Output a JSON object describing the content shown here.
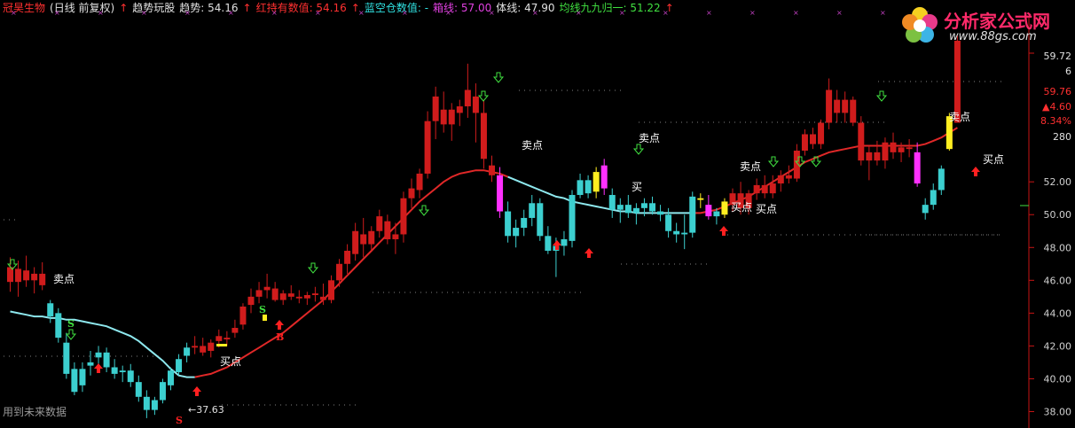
{
  "header": {
    "stock": "冠昊生物",
    "period": "(日线 前复权)",
    "indicator": "趋势玩股",
    "trend_label": "趋势: 54.16",
    "red_hold_label": "红持有数值: 54.16",
    "blue_empty_label": "蓝空仓数值: -",
    "box_label": "箱线: 57.00",
    "body_label": "体线: 47.90",
    "ma_label": "均线九九归一: 51.22",
    "colors": {
      "stock": "#ff3030",
      "white": "#e0e0e0",
      "red": "#ff3030",
      "cyan": "#30e0e0",
      "magenta": "#e040e0",
      "green": "#40e040"
    }
  },
  "watermark": "用到未来数据",
  "logo": {
    "text": "分析家公式网",
    "url": "www.88gs.com"
  },
  "chart_data": {
    "type": "candlestick",
    "ylim": [
      37,
      62
    ],
    "y_ticks": [
      38.0,
      40.0,
      42.0,
      44.0,
      46.0,
      48.0,
      50.0,
      52.0
    ],
    "right_labels": [
      "59.72",
      "6",
      "59.76",
      "▲4.60",
      "8.34%",
      "280"
    ],
    "low_marker": "←37.63",
    "up_color": "#d01c1c",
    "down_color": "#3ccfcf",
    "candles": [
      {
        "o": 46.8,
        "h": 47.4,
        "l": 45.3,
        "c": 45.9,
        "d": "up"
      },
      {
        "o": 45.9,
        "h": 47.2,
        "l": 45.0,
        "c": 46.7,
        "d": "up"
      },
      {
        "o": 46.6,
        "h": 47.5,
        "l": 45.6,
        "c": 46.0,
        "d": "up"
      },
      {
        "o": 46.0,
        "h": 46.8,
        "l": 45.2,
        "c": 46.4,
        "d": "up"
      },
      {
        "o": 46.4,
        "h": 47.1,
        "l": 45.4,
        "c": 45.7,
        "d": "up"
      },
      {
        "o": 44.6,
        "h": 44.8,
        "l": 43.4,
        "c": 43.8,
        "d": "dn"
      },
      {
        "o": 44.0,
        "h": 44.3,
        "l": 42.2,
        "c": 42.5,
        "d": "dn"
      },
      {
        "o": 42.2,
        "h": 42.8,
        "l": 40.0,
        "c": 40.3,
        "d": "dn"
      },
      {
        "o": 40.6,
        "h": 41.0,
        "l": 39.0,
        "c": 39.2,
        "d": "dn"
      },
      {
        "o": 39.6,
        "h": 41.0,
        "l": 39.2,
        "c": 40.6,
        "d": "dn"
      },
      {
        "o": 40.8,
        "h": 41.7,
        "l": 40.2,
        "c": 41.0,
        "d": "dn"
      },
      {
        "o": 41.3,
        "h": 42.0,
        "l": 40.6,
        "c": 41.6,
        "d": "dn"
      },
      {
        "o": 41.6,
        "h": 41.9,
        "l": 40.4,
        "c": 40.7,
        "d": "dn"
      },
      {
        "o": 40.7,
        "h": 41.2,
        "l": 40.0,
        "c": 40.3,
        "d": "dn"
      },
      {
        "o": 40.4,
        "h": 40.8,
        "l": 39.8,
        "c": 40.5,
        "d": "dn"
      },
      {
        "o": 40.5,
        "h": 40.9,
        "l": 39.5,
        "c": 39.8,
        "d": "dn"
      },
      {
        "o": 39.8,
        "h": 40.2,
        "l": 38.6,
        "c": 38.9,
        "d": "dn"
      },
      {
        "o": 38.9,
        "h": 39.3,
        "l": 37.6,
        "c": 38.1,
        "d": "dn"
      },
      {
        "o": 38.1,
        "h": 38.9,
        "l": 37.8,
        "c": 38.7,
        "d": "dn"
      },
      {
        "o": 38.7,
        "h": 40.0,
        "l": 38.5,
        "c": 39.8,
        "d": "dn"
      },
      {
        "o": 39.6,
        "h": 40.7,
        "l": 39.3,
        "c": 40.5,
        "d": "dn"
      },
      {
        "o": 40.4,
        "h": 41.5,
        "l": 40.2,
        "c": 41.2,
        "d": "dn"
      },
      {
        "o": 41.4,
        "h": 42.2,
        "l": 41.0,
        "c": 41.9,
        "d": "dn"
      },
      {
        "o": 41.9,
        "h": 42.6,
        "l": 41.5,
        "c": 42.0,
        "d": "up"
      },
      {
        "o": 42.0,
        "h": 42.5,
        "l": 41.4,
        "c": 41.6,
        "d": "up"
      },
      {
        "o": 41.7,
        "h": 42.4,
        "l": 41.3,
        "c": 42.2,
        "d": "up"
      },
      {
        "o": 42.3,
        "h": 43.0,
        "l": 41.9,
        "c": 42.6,
        "d": "up"
      },
      {
        "o": 42.5,
        "h": 42.9,
        "l": 42.0,
        "c": 42.4,
        "d": "up"
      },
      {
        "o": 42.8,
        "h": 43.6,
        "l": 42.5,
        "c": 43.1,
        "d": "up"
      },
      {
        "o": 43.3,
        "h": 44.6,
        "l": 43.0,
        "c": 44.4,
        "d": "up"
      },
      {
        "o": 44.5,
        "h": 45.5,
        "l": 44.0,
        "c": 45.0,
        "d": "up"
      },
      {
        "o": 45.0,
        "h": 45.9,
        "l": 44.6,
        "c": 45.4,
        "d": "up"
      },
      {
        "o": 45.4,
        "h": 46.4,
        "l": 44.9,
        "c": 45.6,
        "d": "up"
      },
      {
        "o": 45.5,
        "h": 45.9,
        "l": 44.7,
        "c": 44.8,
        "d": "up"
      },
      {
        "o": 44.8,
        "h": 45.4,
        "l": 44.5,
        "c": 45.2,
        "d": "up"
      },
      {
        "o": 45.2,
        "h": 45.7,
        "l": 44.8,
        "c": 45.0,
        "d": "up"
      },
      {
        "o": 45.0,
        "h": 45.4,
        "l": 44.6,
        "c": 44.9,
        "d": "up"
      },
      {
        "o": 44.9,
        "h": 45.3,
        "l": 44.5,
        "c": 45.1,
        "d": "up"
      },
      {
        "o": 45.1,
        "h": 45.6,
        "l": 44.7,
        "c": 45.2,
        "d": "up"
      },
      {
        "o": 45.0,
        "h": 45.8,
        "l": 44.5,
        "c": 44.8,
        "d": "up"
      },
      {
        "o": 44.8,
        "h": 46.3,
        "l": 44.6,
        "c": 46.0,
        "d": "up"
      },
      {
        "o": 46.0,
        "h": 47.3,
        "l": 45.6,
        "c": 47.0,
        "d": "up"
      },
      {
        "o": 47.0,
        "h": 48.2,
        "l": 46.4,
        "c": 47.8,
        "d": "up"
      },
      {
        "o": 47.6,
        "h": 49.5,
        "l": 47.2,
        "c": 49.0,
        "d": "up"
      },
      {
        "o": 48.8,
        "h": 49.8,
        "l": 47.4,
        "c": 48.2,
        "d": "up"
      },
      {
        "o": 48.2,
        "h": 49.3,
        "l": 47.8,
        "c": 49.0,
        "d": "up"
      },
      {
        "o": 49.0,
        "h": 50.3,
        "l": 48.6,
        "c": 49.9,
        "d": "up"
      },
      {
        "o": 49.6,
        "h": 50.0,
        "l": 48.2,
        "c": 48.5,
        "d": "up"
      },
      {
        "o": 48.5,
        "h": 49.5,
        "l": 47.6,
        "c": 48.8,
        "d": "up"
      },
      {
        "o": 48.8,
        "h": 51.4,
        "l": 48.3,
        "c": 51.0,
        "d": "up"
      },
      {
        "o": 51.0,
        "h": 52.2,
        "l": 50.4,
        "c": 51.6,
        "d": "up"
      },
      {
        "o": 51.5,
        "h": 52.8,
        "l": 51.0,
        "c": 52.5,
        "d": "up"
      },
      {
        "o": 52.5,
        "h": 56.3,
        "l": 52.2,
        "c": 55.7,
        "d": "up"
      },
      {
        "o": 55.7,
        "h": 57.8,
        "l": 54.6,
        "c": 57.2,
        "d": "up"
      },
      {
        "o": 56.4,
        "h": 57.5,
        "l": 55.0,
        "c": 55.5,
        "d": "up"
      },
      {
        "o": 55.5,
        "h": 56.8,
        "l": 54.5,
        "c": 56.4,
        "d": "up"
      },
      {
        "o": 56.2,
        "h": 57.0,
        "l": 55.4,
        "c": 56.6,
        "d": "up"
      },
      {
        "o": 56.6,
        "h": 59.2,
        "l": 55.9,
        "c": 57.6,
        "d": "up"
      },
      {
        "o": 57.2,
        "h": 58.0,
        "l": 54.4,
        "c": 56.2,
        "d": "up"
      },
      {
        "o": 56.2,
        "h": 57.0,
        "l": 52.8,
        "c": 53.4,
        "d": "up"
      },
      {
        "o": 53.0,
        "h": 53.6,
        "l": 52.0,
        "c": 52.4,
        "d": "up"
      },
      {
        "o": 52.4,
        "h": 52.9,
        "l": 49.8,
        "c": 50.2,
        "d": "mag"
      },
      {
        "o": 50.2,
        "h": 50.8,
        "l": 48.3,
        "c": 48.7,
        "d": "dn"
      },
      {
        "o": 48.7,
        "h": 49.7,
        "l": 48.0,
        "c": 49.2,
        "d": "dn"
      },
      {
        "o": 49.2,
        "h": 50.3,
        "l": 48.7,
        "c": 49.8,
        "d": "dn"
      },
      {
        "o": 49.8,
        "h": 51.2,
        "l": 49.3,
        "c": 50.7,
        "d": "dn"
      },
      {
        "o": 50.7,
        "h": 51.0,
        "l": 48.4,
        "c": 48.7,
        "d": "dn"
      },
      {
        "o": 48.7,
        "h": 49.3,
        "l": 47.6,
        "c": 47.8,
        "d": "dn"
      },
      {
        "o": 47.8,
        "h": 48.6,
        "l": 46.2,
        "c": 48.1,
        "d": "dn"
      },
      {
        "o": 48.1,
        "h": 49.0,
        "l": 47.5,
        "c": 48.5,
        "d": "dn"
      },
      {
        "o": 48.4,
        "h": 51.5,
        "l": 48.0,
        "c": 51.2,
        "d": "dn"
      },
      {
        "o": 51.2,
        "h": 52.5,
        "l": 51.0,
        "c": 52.1,
        "d": "dn"
      },
      {
        "o": 52.1,
        "h": 52.4,
        "l": 51.0,
        "c": 51.3,
        "d": "dn"
      },
      {
        "o": 51.4,
        "h": 52.9,
        "l": 51.0,
        "c": 52.6,
        "d": "ylw"
      },
      {
        "o": 51.6,
        "h": 53.4,
        "l": 51.2,
        "c": 53.0,
        "d": "mag"
      },
      {
        "o": 51.2,
        "h": 51.6,
        "l": 49.8,
        "c": 50.3,
        "d": "dn"
      },
      {
        "o": 50.3,
        "h": 51.0,
        "l": 49.5,
        "c": 50.6,
        "d": "dn"
      },
      {
        "o": 50.6,
        "h": 51.2,
        "l": 49.8,
        "c": 50.1,
        "d": "dn"
      },
      {
        "o": 50.1,
        "h": 50.7,
        "l": 49.4,
        "c": 50.4,
        "d": "dn"
      },
      {
        "o": 50.4,
        "h": 51.0,
        "l": 49.9,
        "c": 50.7,
        "d": "dn"
      },
      {
        "o": 50.7,
        "h": 51.1,
        "l": 50.0,
        "c": 50.2,
        "d": "dn"
      },
      {
        "o": 50.2,
        "h": 50.6,
        "l": 49.6,
        "c": 50.0,
        "d": "dn"
      },
      {
        "o": 50.0,
        "h": 50.4,
        "l": 48.6,
        "c": 49.0,
        "d": "dn"
      },
      {
        "o": 49.0,
        "h": 49.5,
        "l": 48.3,
        "c": 48.8,
        "d": "dn"
      },
      {
        "o": 48.8,
        "h": 50.0,
        "l": 47.9,
        "c": 48.9,
        "d": "dn"
      },
      {
        "o": 48.9,
        "h": 51.4,
        "l": 48.6,
        "c": 51.1,
        "d": "dn"
      },
      {
        "o": 50.9,
        "h": 51.3,
        "l": 50.4,
        "c": 51.0,
        "d": "ylw"
      },
      {
        "o": 50.6,
        "h": 51.2,
        "l": 49.7,
        "c": 49.9,
        "d": "mag"
      },
      {
        "o": 49.9,
        "h": 50.4,
        "l": 49.4,
        "c": 50.2,
        "d": "dn"
      },
      {
        "o": 50.0,
        "h": 51.0,
        "l": 49.8,
        "c": 50.8,
        "d": "ylw"
      },
      {
        "o": 50.6,
        "h": 51.6,
        "l": 50.2,
        "c": 51.3,
        "d": "up"
      },
      {
        "o": 51.3,
        "h": 52.0,
        "l": 50.0,
        "c": 50.4,
        "d": "up"
      },
      {
        "o": 50.4,
        "h": 51.5,
        "l": 50.0,
        "c": 51.3,
        "d": "up"
      },
      {
        "o": 51.3,
        "h": 52.2,
        "l": 50.9,
        "c": 51.8,
        "d": "up"
      },
      {
        "o": 51.8,
        "h": 52.4,
        "l": 51.0,
        "c": 51.3,
        "d": "up"
      },
      {
        "o": 51.3,
        "h": 52.4,
        "l": 51.0,
        "c": 51.9,
        "d": "up"
      },
      {
        "o": 51.9,
        "h": 52.7,
        "l": 51.4,
        "c": 52.4,
        "d": "up"
      },
      {
        "o": 52.4,
        "h": 53.0,
        "l": 51.9,
        "c": 52.2,
        "d": "up"
      },
      {
        "o": 52.2,
        "h": 54.3,
        "l": 52.0,
        "c": 53.9,
        "d": "up"
      },
      {
        "o": 53.9,
        "h": 55.2,
        "l": 53.6,
        "c": 54.9,
        "d": "up"
      },
      {
        "o": 54.9,
        "h": 55.3,
        "l": 54.0,
        "c": 54.3,
        "d": "up"
      },
      {
        "o": 54.3,
        "h": 55.8,
        "l": 54.0,
        "c": 55.6,
        "d": "up"
      },
      {
        "o": 55.6,
        "h": 58.3,
        "l": 55.2,
        "c": 57.6,
        "d": "up"
      },
      {
        "o": 57.0,
        "h": 57.6,
        "l": 55.6,
        "c": 56.2,
        "d": "up"
      },
      {
        "o": 56.2,
        "h": 57.5,
        "l": 55.6,
        "c": 57.0,
        "d": "up"
      },
      {
        "o": 57.0,
        "h": 57.2,
        "l": 55.4,
        "c": 55.6,
        "d": "up"
      },
      {
        "o": 55.6,
        "h": 56.0,
        "l": 53.0,
        "c": 53.3,
        "d": "up"
      },
      {
        "o": 53.3,
        "h": 54.2,
        "l": 52.1,
        "c": 53.8,
        "d": "up"
      },
      {
        "o": 53.8,
        "h": 54.5,
        "l": 53.0,
        "c": 53.3,
        "d": "up"
      },
      {
        "o": 53.3,
        "h": 54.7,
        "l": 52.8,
        "c": 54.4,
        "d": "up"
      },
      {
        "o": 54.4,
        "h": 55.0,
        "l": 53.4,
        "c": 53.8,
        "d": "up"
      },
      {
        "o": 53.8,
        "h": 54.4,
        "l": 53.2,
        "c": 54.1,
        "d": "up"
      },
      {
        "o": 54.1,
        "h": 54.6,
        "l": 53.5,
        "c": 54.0,
        "d": "up"
      },
      {
        "o": 53.8,
        "h": 54.4,
        "l": 51.7,
        "c": 51.9,
        "d": "mag"
      },
      {
        "o": 50.6,
        "h": 51.0,
        "l": 49.7,
        "c": 50.1,
        "d": "dn"
      },
      {
        "o": 50.6,
        "h": 51.9,
        "l": 50.3,
        "c": 51.5,
        "d": "dn"
      },
      {
        "o": 51.5,
        "h": 53.0,
        "l": 51.2,
        "c": 52.8,
        "d": "dn"
      },
      {
        "o": 54.0,
        "h": 56.2,
        "l": 53.9,
        "c": 56.0,
        "d": "ylw"
      },
      {
        "o": 55.6,
        "h": 60.9,
        "l": 55.6,
        "c": 60.6,
        "d": "up"
      }
    ],
    "ma_line": {
      "name": "均线九九归一",
      "values": [
        44.1,
        44.0,
        43.9,
        43.8,
        43.8,
        43.7,
        43.7,
        43.6,
        43.6,
        43.5,
        43.4,
        43.3,
        43.2,
        43.0,
        42.8,
        42.6,
        42.3,
        41.9,
        41.5,
        41.1,
        40.6,
        40.2,
        40.1,
        40.1,
        40.2,
        40.3,
        40.5,
        40.7,
        41.0,
        41.3,
        41.6,
        41.9,
        42.2,
        42.5,
        42.8,
        43.2,
        43.6,
        44.0,
        44.4,
        44.8,
        45.3,
        45.8,
        46.3,
        46.8,
        47.3,
        47.8,
        48.3,
        48.8,
        49.3,
        49.8,
        50.3,
        50.8,
        51.2,
        51.6,
        52.0,
        52.3,
        52.5,
        52.6,
        52.7,
        52.7,
        52.6,
        52.5,
        52.3,
        52.1,
        51.9,
        51.7,
        51.5,
        51.3,
        51.1,
        51.0,
        50.8,
        50.7,
        50.6,
        50.5,
        50.4,
        50.3,
        50.2,
        50.2,
        50.1,
        50.1,
        50.1,
        50.1,
        50.1,
        50.1,
        50.1,
        50.1,
        50.1,
        50.2,
        50.3,
        50.5,
        50.7,
        50.9,
        51.1,
        51.4,
        51.7,
        52.0,
        52.3,
        52.6,
        52.9,
        53.2,
        53.4,
        53.6,
        53.8,
        53.9,
        54.0,
        54.1,
        54.2,
        54.2,
        54.2,
        54.2,
        54.2,
        54.2,
        54.2,
        54.2,
        54.3,
        54.5,
        54.7,
        55.0,
        55.3
      ]
    }
  }
}
